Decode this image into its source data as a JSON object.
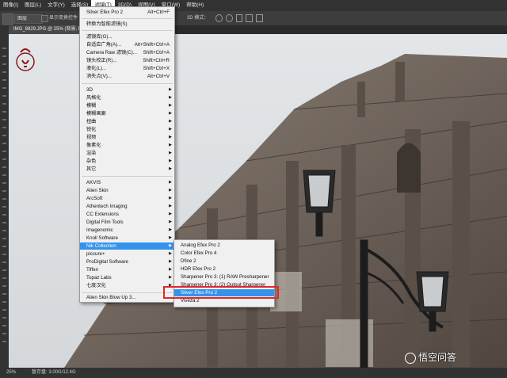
{
  "menubar": {
    "items": [
      {
        "label": "图像(I)"
      },
      {
        "label": "图层(L)"
      },
      {
        "label": "文字(Y)"
      },
      {
        "label": "选择(S)"
      },
      {
        "label": "滤镜(T)"
      },
      {
        "label": "3D(D)"
      },
      {
        "label": "视图(V)"
      },
      {
        "label": "窗口(W)"
      },
      {
        "label": "帮助(H)"
      }
    ]
  },
  "options_bar": {
    "layer_select": "图层",
    "checkbox_label": "显示变换控件",
    "mode_label": "3D 模式："
  },
  "document": {
    "tab_title": "IMG_8829.JPG @ 25% (背景, RGB/8)"
  },
  "status": {
    "zoom": "25%",
    "doc_size": "暂存盘: 3.00G/12.4G"
  },
  "filter_menu": {
    "items": [
      {
        "label": "Silver Efex Pro 2",
        "shortcut": "Alt+Ctrl+F"
      },
      {
        "label": "转换为智能滤镜(S)"
      },
      {
        "label": "滤镜库(G)..."
      },
      {
        "label": "自适应广角(A)...",
        "shortcut": "Alt+Shift+Ctrl+A"
      },
      {
        "label": "Camera Raw 滤镜(C)...",
        "shortcut": "Shift+Ctrl+A"
      },
      {
        "label": "镜头校正(R)...",
        "shortcut": "Shift+Ctrl+R"
      },
      {
        "label": "液化(L)...",
        "shortcut": "Shift+Ctrl+X"
      },
      {
        "label": "消失点(V)...",
        "shortcut": "Alt+Ctrl+V"
      },
      {
        "label": "3D"
      },
      {
        "label": "风格化"
      },
      {
        "label": "模糊"
      },
      {
        "label": "模糊画廊"
      },
      {
        "label": "扭曲"
      },
      {
        "label": "锐化"
      },
      {
        "label": "视频"
      },
      {
        "label": "像素化"
      },
      {
        "label": "渲染"
      },
      {
        "label": "杂色"
      },
      {
        "label": "其它"
      },
      {
        "label": "AKVIS"
      },
      {
        "label": "Alien Skin"
      },
      {
        "label": "ArcSoft"
      },
      {
        "label": "Athentech Imaging"
      },
      {
        "label": "CC Extensions"
      },
      {
        "label": "Digital Film Tools"
      },
      {
        "label": "Imagenomic"
      },
      {
        "label": "Knoll Software"
      },
      {
        "label": "Nik Collection"
      },
      {
        "label": "piccure+"
      },
      {
        "label": "ProDigital Software"
      },
      {
        "label": "Tiffen"
      },
      {
        "label": "Topaz Labs"
      },
      {
        "label": "七度汉化"
      },
      {
        "label": "Alien Skin Blow Up 3..."
      }
    ]
  },
  "nik_submenu": {
    "items": [
      {
        "label": "Analog Efex Pro 2"
      },
      {
        "label": "Color Efex Pro 4"
      },
      {
        "label": "Dfine 2"
      },
      {
        "label": "HDR Efex Pro 2"
      },
      {
        "label": "Sharpener Pro 3: (1) RAW Presharpener"
      },
      {
        "label": "Sharpener Pro 3: (2) Output Sharpener"
      },
      {
        "label": "Silver Efex Pro 2"
      },
      {
        "label": "Viveza 2"
      }
    ]
  },
  "watermark": {
    "text": "悟空问答"
  },
  "colors": {
    "menu_highlight": "#3393ea",
    "callout_red": "#e8242a",
    "app_dark": "#323232"
  }
}
